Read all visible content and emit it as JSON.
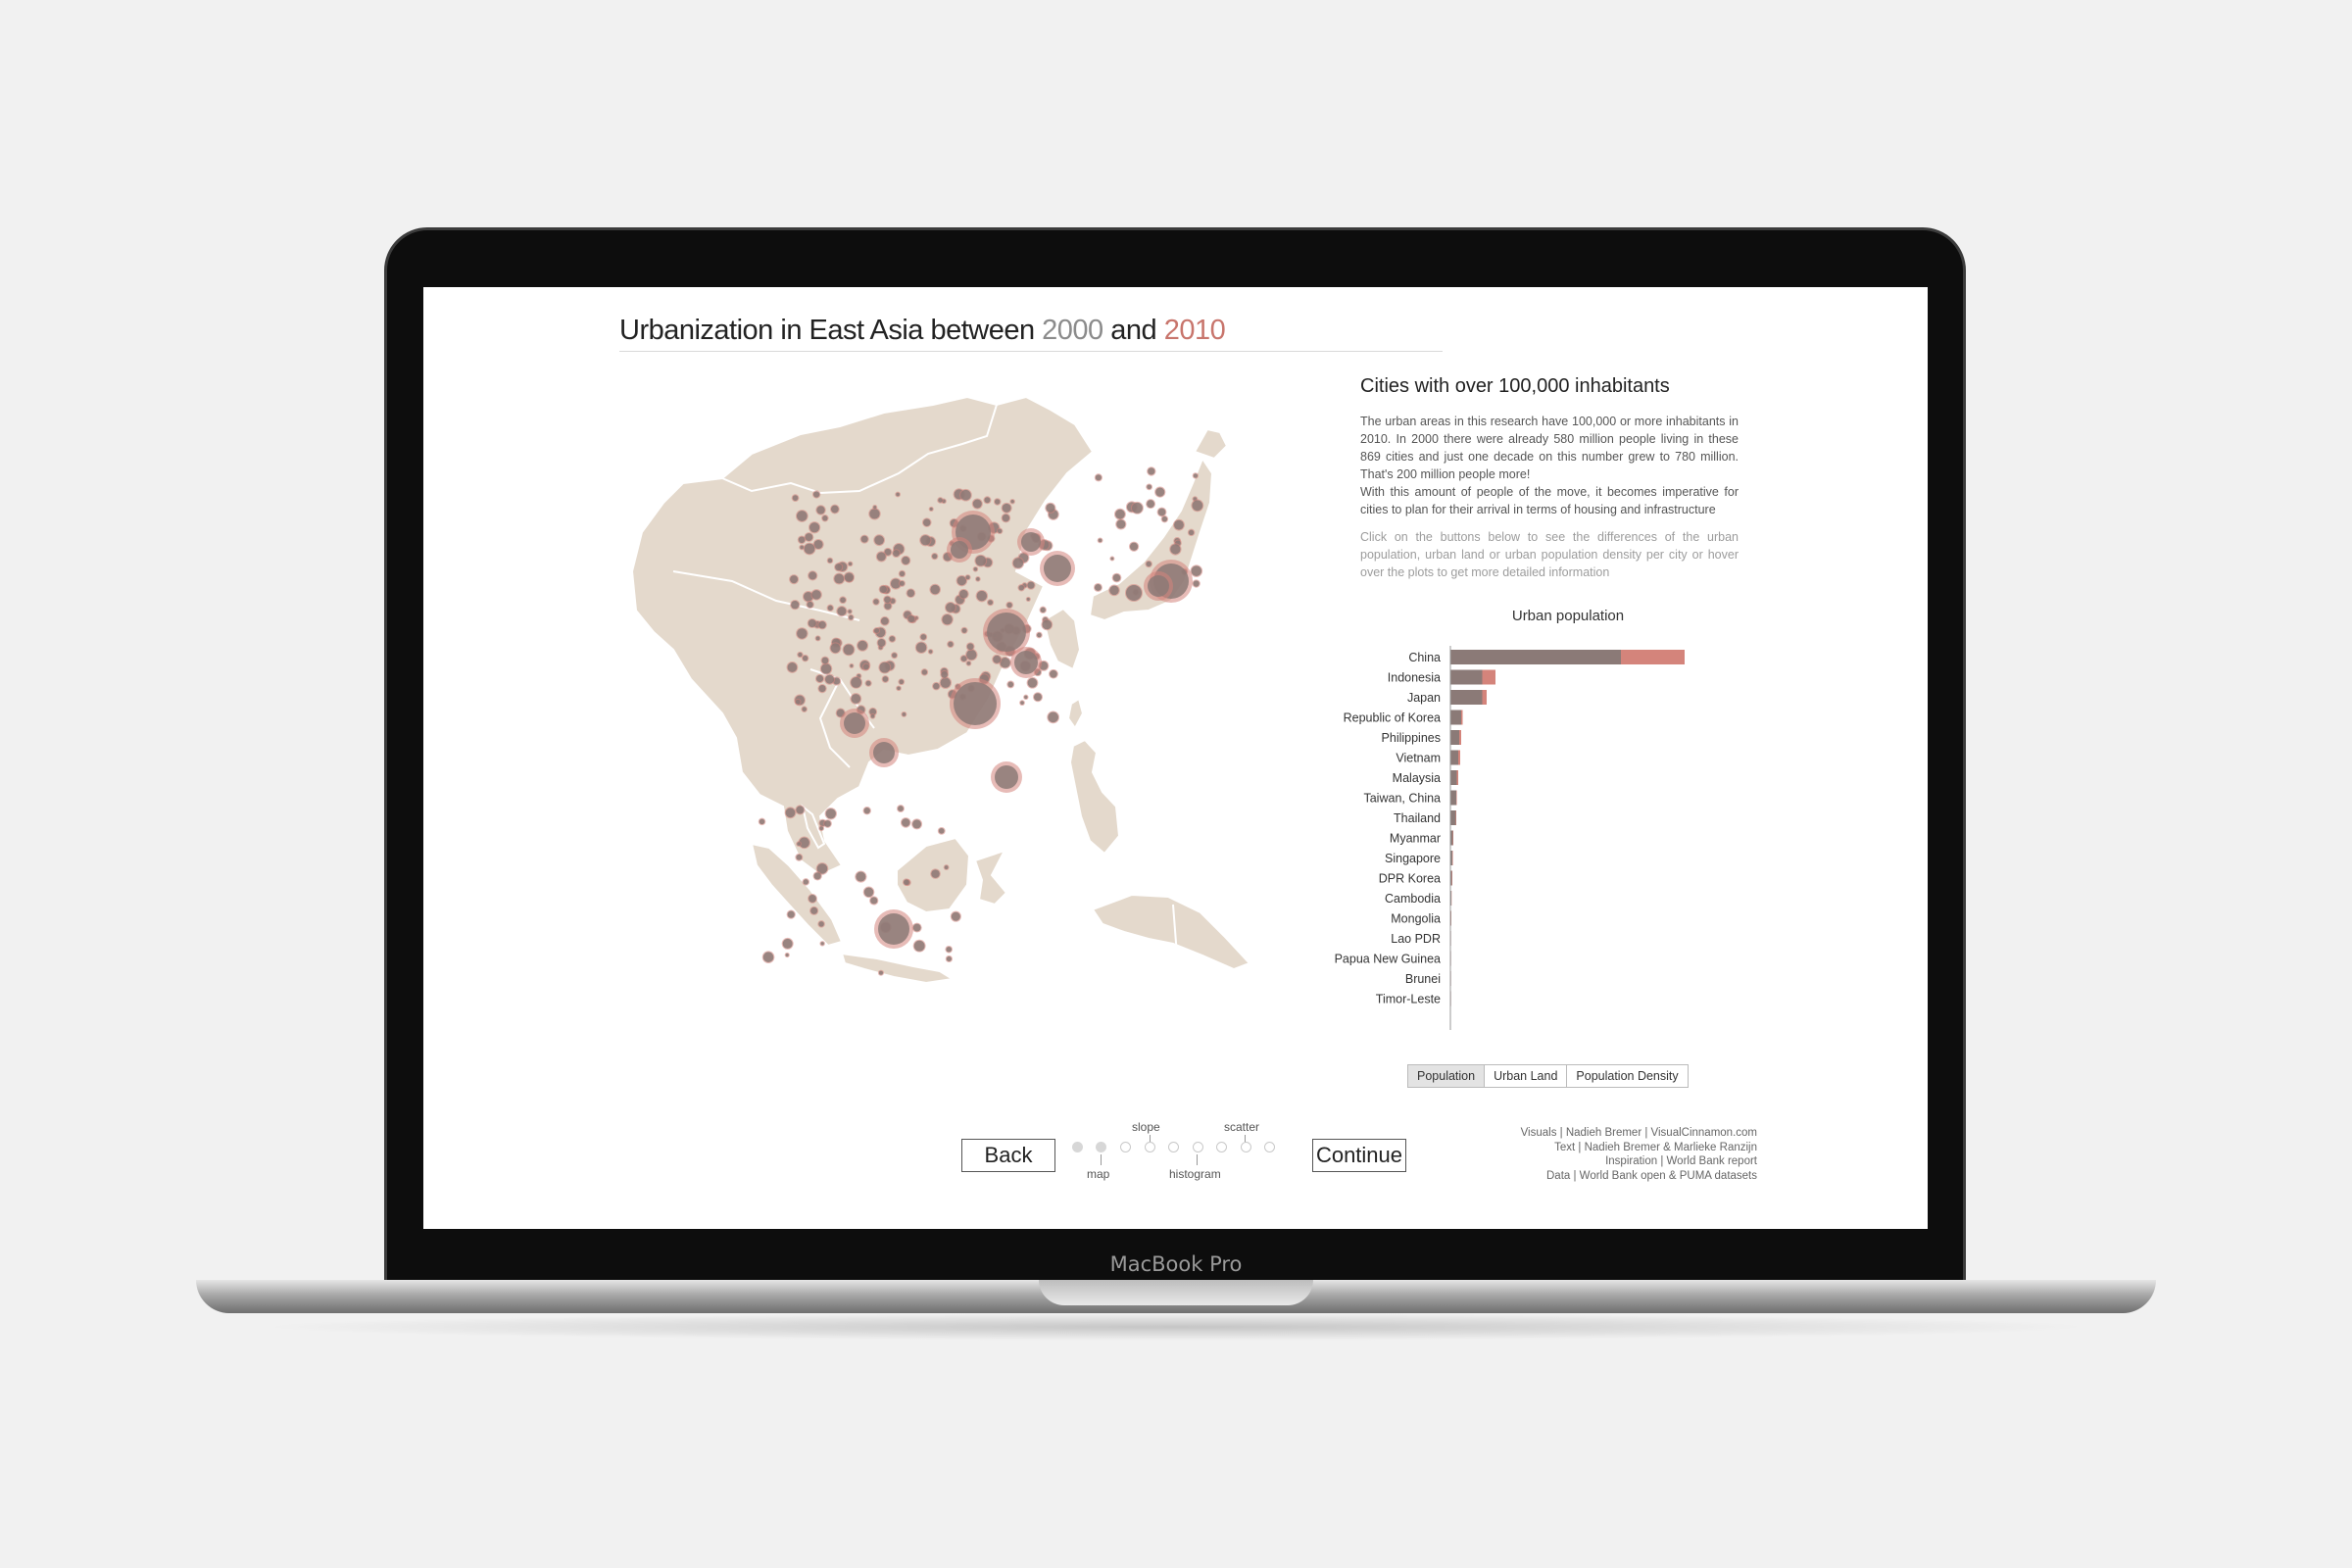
{
  "device": {
    "label": "MacBook Pro"
  },
  "header": {
    "title_prefix": "Urbanization in East Asia between",
    "year_a": "2000",
    "and": "and",
    "year_b": "2010"
  },
  "colors": {
    "year_2000": "#8b7a77",
    "year_2010": "#d4847b",
    "land": "#e4d9cc",
    "border": "#ffffff"
  },
  "info": {
    "title": "Cities with over 100,000 inhabitants",
    "paragraph_1": "The urban areas in this research have 100,000 or more inhabitants in 2010. In 2000 there were already 580 million people living in these 869 cities and just one decade on this number grew to 780 million. That's 200 million people more!",
    "paragraph_2": "With this amount of people of the move, it becomes imperative for cities to plan for their arrival in terms of housing and infrastructure",
    "hint": "Click on the buttons below to see the differences of the urban population, urban land or urban population density per city or hover over the plots to get more detailed information"
  },
  "chart_data": {
    "type": "bar",
    "title": "Urban population",
    "orientation": "horizontal",
    "categories": [
      "China",
      "Indonesia",
      "Japan",
      "Republic of Korea",
      "Philippines",
      "Vietnam",
      "Malaysia",
      "Taiwan, China",
      "Thailand",
      "Myanmar",
      "Singapore",
      "DPR Korea",
      "Cambodia",
      "Mongolia",
      "Lao PDR",
      "Papua New Guinea",
      "Brunei",
      "Timor-Leste"
    ],
    "series": [
      {
        "name": "2000",
        "values": [
          348,
          65,
          65,
          22,
          18,
          16,
          13,
          12,
          11,
          5,
          4,
          3,
          2,
          1.5,
          0.8,
          0.5,
          0.3,
          0.2
        ]
      },
      {
        "name": "2010",
        "values": [
          478,
          92,
          74,
          25,
          22,
          20,
          16,
          13,
          12,
          6,
          5,
          4,
          2.5,
          2,
          1,
          0.6,
          0.4,
          0.3
        ]
      }
    ],
    "xlim": [
      0,
      480
    ],
    "xticks": [
      "0.0",
      "100M",
      "200M",
      "300M",
      "400M"
    ]
  },
  "metric_buttons": [
    "Population",
    "Urban Land",
    "Population Density"
  ],
  "navigation": {
    "back_label": "Back",
    "continue_label": "Continue",
    "steps_top": [
      "slope",
      "scatter"
    ],
    "steps_bottom": [
      "map",
      "histogram"
    ]
  },
  "credits": [
    "Visuals | Nadieh Bremer | VisualCinnamon.com",
    "Text | Nadieh Bremer & Marlieke Ranzijn",
    "Inspiration | World Bank report",
    "Data | World Bank open & PUMA datasets"
  ]
}
